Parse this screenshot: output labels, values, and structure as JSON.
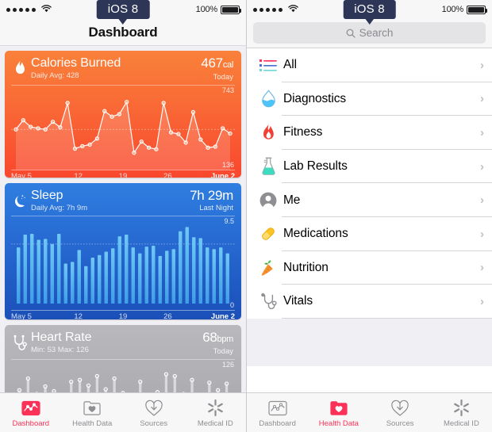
{
  "badge": {
    "label": "iOS 8"
  },
  "status_bar": {
    "signal_dots": 5,
    "wifi_icon": "wifi-icon",
    "battery_percent": "100%",
    "battery_icon": "battery-full-icon"
  },
  "left_screen": {
    "nav_title": "Dashboard",
    "cards": [
      {
        "id": "calories",
        "icon": "flame-icon",
        "title": "Calories Burned",
        "subtitle": "Daily Avg: 428",
        "value": "467",
        "unit": "cal",
        "when": "Today",
        "max_label": "743",
        "min_label": "136",
        "axis": [
          "May 5",
          "12",
          "19",
          "26",
          "June 2"
        ]
      },
      {
        "id": "sleep",
        "icon": "moon-icon",
        "title": "Sleep",
        "subtitle": "Daily Avg: 7h 9m",
        "value": "7h 29m",
        "unit": "",
        "when": "Last Night",
        "max_label": "9.5",
        "min_label": "0",
        "axis": [
          "May 5",
          "12",
          "19",
          "26",
          "June 2"
        ]
      },
      {
        "id": "heart",
        "icon": "stethoscope-icon",
        "title": "Heart Rate",
        "subtitle": "Min: 53 Max: 126",
        "value": "68",
        "unit": "bpm",
        "when": "Today",
        "max_label": "126",
        "min_label": "",
        "axis": []
      }
    ],
    "tabs": [
      {
        "label": "Dashboard",
        "icon": "chart-line-icon",
        "active": true
      },
      {
        "label": "Health Data",
        "icon": "folder-heart-icon",
        "active": false
      },
      {
        "label": "Sources",
        "icon": "download-heart-icon",
        "active": false
      },
      {
        "label": "Medical ID",
        "icon": "asterisk-medical-icon",
        "active": false
      }
    ]
  },
  "right_screen": {
    "search": {
      "placeholder": "Search",
      "icon": "search-icon"
    },
    "rows": [
      {
        "label": "All",
        "icon": "list-bullets-icon",
        "chevron": "›"
      },
      {
        "label": "Diagnostics",
        "icon": "water-drop-icon",
        "chevron": "›"
      },
      {
        "label": "Fitness",
        "icon": "flame-icon",
        "chevron": "›"
      },
      {
        "label": "Lab Results",
        "icon": "flask-icon",
        "chevron": "›"
      },
      {
        "label": "Me",
        "icon": "person-icon",
        "chevron": "›"
      },
      {
        "label": "Medications",
        "icon": "pill-icon",
        "chevron": "›"
      },
      {
        "label": "Nutrition",
        "icon": "carrot-icon",
        "chevron": "›"
      },
      {
        "label": "Vitals",
        "icon": "stethoscope-icon",
        "chevron": "›"
      }
    ],
    "tabs": [
      {
        "label": "Dashboard",
        "icon": "chart-line-icon",
        "active": false
      },
      {
        "label": "Health Data",
        "icon": "folder-heart-icon",
        "active": true
      },
      {
        "label": "Sources",
        "icon": "download-heart-icon",
        "active": false
      },
      {
        "label": "Medical ID",
        "icon": "asterisk-medical-icon",
        "active": false
      }
    ]
  },
  "colors": {
    "accent_red": "#fc3158",
    "calories_top": "#f9813a",
    "calories_bottom": "#f9472e",
    "sleep_top": "#2f7ee0",
    "sleep_bottom": "#1b4fb8",
    "heart_gray": "#b0b0b5",
    "badge_navy": "#2d3657"
  },
  "chart_data": [
    {
      "type": "line",
      "title": "Calories Burned",
      "ylabel": "cal",
      "ylim": [
        136,
        743
      ],
      "categories": [
        "May 5",
        "12",
        "19",
        "26",
        "June 2"
      ],
      "values": [
        430,
        520,
        455,
        440,
        430,
        505,
        450,
        690,
        240,
        265,
        280,
        340,
        610,
        555,
        580,
        700,
        200,
        310,
        250,
        235,
        690,
        400,
        385,
        300,
        600,
        330,
        250,
        260,
        440,
        390
      ],
      "grid": true
    },
    {
      "type": "bar",
      "title": "Sleep",
      "ylabel": "h",
      "ylim": [
        0,
        9.5
      ],
      "categories": [
        "May 5",
        "12",
        "19",
        "26",
        "June 2"
      ],
      "values": [
        6.6,
        8.1,
        8.2,
        7.5,
        7.6,
        7.0,
        8.2,
        4.7,
        4.9,
        6.3,
        4.4,
        5.4,
        5.7,
        6.1,
        6.5,
        7.9,
        8.1,
        6.6,
        5.9,
        6.7,
        6.8,
        5.6,
        6.2,
        6.4,
        8.5,
        9.0,
        7.8,
        7.7,
        6.6,
        6.4,
        6.6,
        5.9
      ],
      "grid": true
    },
    {
      "type": "bar",
      "title": "Heart Rate",
      "ylabel": "bpm",
      "ylim": [
        53,
        126
      ],
      "categories": [],
      "values": [
        70,
        95,
        62,
        78,
        68,
        58,
        88,
        92,
        80,
        100,
        72,
        95,
        64,
        60,
        88,
        60,
        66,
        104,
        100,
        62,
        92,
        58,
        86,
        70,
        84
      ],
      "grid": false
    }
  ]
}
